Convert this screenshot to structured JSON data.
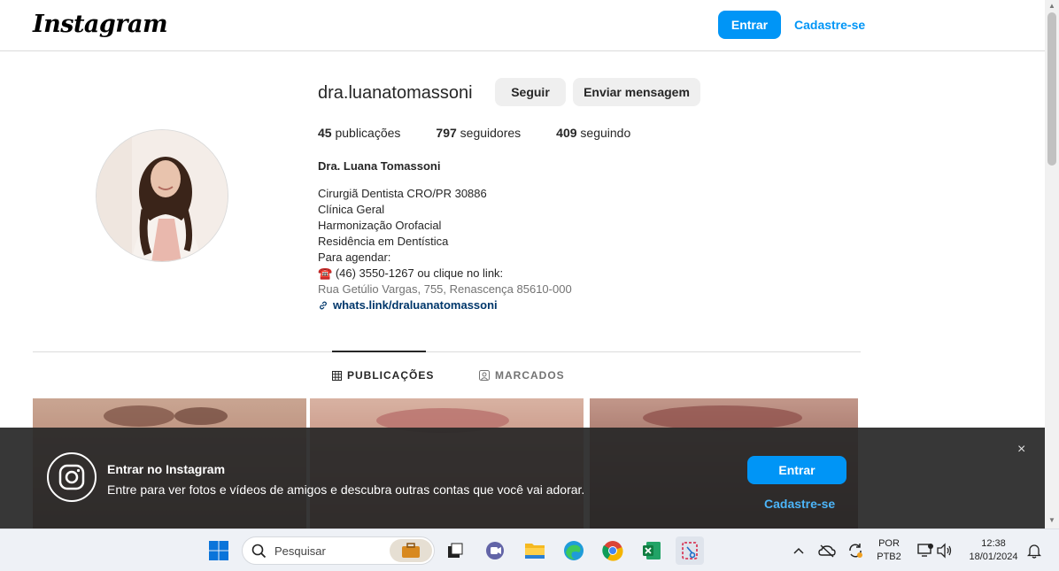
{
  "header": {
    "logo": "Instagram",
    "login_label": "Entrar",
    "signup_label": "Cadastre-se"
  },
  "profile": {
    "username": "dra.luanatomassoni",
    "follow_label": "Seguir",
    "message_label": "Enviar mensagem",
    "posts_count": "45",
    "posts_label": "publicações",
    "followers_count": "797",
    "followers_label": "seguidores",
    "following_count": "409",
    "following_label": "seguindo",
    "full_name": "Dra. Luana Tomassoni",
    "bio_lines": [
      "Cirurgiã Dentista CRO/PR 30886",
      "Clínica Geral",
      "Harmonização Orofacial",
      "Residência em Dentística",
      "Para agendar:"
    ],
    "phone_emoji": "☎️",
    "phone_line": "(46) 3550-1267 ou clique no link:",
    "address": "Rua Getúlio Vargas, 755, Renascença 85610-000",
    "link": "whats.link/draluanatomassoni"
  },
  "tabs": [
    {
      "label": "PUBLICAÇÕES",
      "active": true
    },
    {
      "label": "MARCADOS",
      "active": false
    }
  ],
  "banner": {
    "title": "Entrar no Instagram",
    "subtitle": "Entre para ver fotos e vídeos de amigos e descubra outras contas que você vai adorar.",
    "login_label": "Entrar",
    "signup_label": "Cadastre-se",
    "close_icon": "×"
  },
  "taskbar": {
    "search_placeholder": "Pesquisar",
    "lang_top": "POR",
    "lang_bottom": "PTB2",
    "time": "12:38",
    "date": "18/01/2024"
  },
  "colors": {
    "accent": "#0095f6",
    "link": "#00376b",
    "banner_bg": "#282828"
  }
}
